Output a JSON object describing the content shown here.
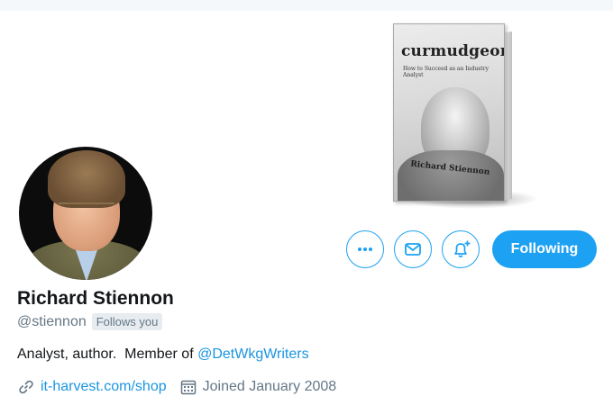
{
  "colors": {
    "accent": "#1da1f2",
    "link": "#1b95e0",
    "secondary_text": "#657786",
    "primary_text": "#14171a"
  },
  "book": {
    "title": "curmudgeon",
    "subtitle": "How to Succeed as an Industry Analyst",
    "author": "Richard Stiennon"
  },
  "profile": {
    "name": "Richard Stiennon",
    "handle": "@stiennon",
    "follows_you": "Follows you",
    "bio_prefix": "Analyst, author.  Member of ",
    "bio_mention": "@DetWkgWriters",
    "website": "it-harvest.com/shop",
    "joined": "Joined January 2008"
  },
  "actions": {
    "more_icon": "more-horizontal-icon",
    "message_icon": "envelope-icon",
    "notify_icon": "bell-plus-icon",
    "following_label": "Following"
  }
}
